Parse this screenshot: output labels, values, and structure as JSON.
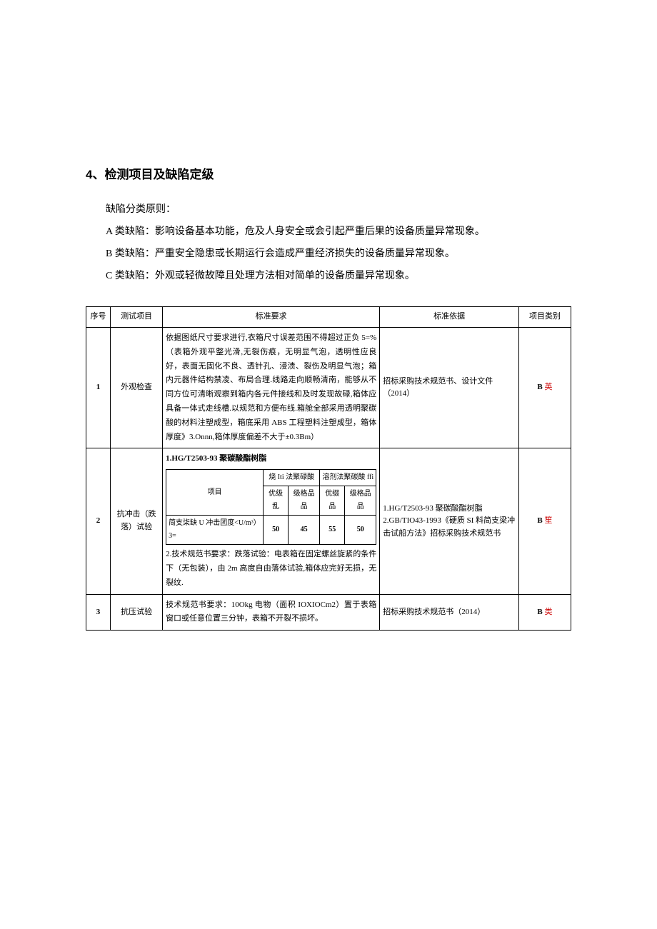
{
  "heading": "4、检测项目及缺陷定级",
  "principles": {
    "intro": "缺陷分类原则：",
    "a": "A 类缺陷：影响设备基本功能，危及人身安全或会引起严重后果的设备质量异常现象。",
    "b": "B 类缺陷：严重安全隐患或长期运行会造成严重经济损失的设备质量异常现象。",
    "c": "C 类缺陷：外观或轻微故障且处理方法相对简单的设备质量异常现象。"
  },
  "table": {
    "headers": {
      "seq": "序号",
      "item": "测试项目",
      "req": "标准要求",
      "basis": "标准依据",
      "cat": "项目类别"
    },
    "rows": [
      {
        "seq": "1",
        "item": "外观检查",
        "req": "依据图纸尺寸要求进行,衣箱尺寸误差范围不得超过正负 5=%（表箱外观平整光滑,无裂伤痕，无明显气泡，透明性应良好，表面无固化不良、透针孔、浸渍、裂伤及明显气泡；箱内元器件结构禁凌、布局合理.线路走向顺畅清南，能够从不同方位可清晰观察到箱内各元件接线和及时发现故碌,箱体应具备一体式走线槽.以规范和方便布线.箱舱全部采用透明聚碳酸的材料注塑成型，箱底采用 ABS 工程塑料注塑成型，箱体厚度》3.Onnn,箱体厚度偏差不大于±0.3Bm）",
        "basis": "招标采购技术规范书、设计文件（2014）",
        "cat_b": "B",
        "cat_lei": "英"
      },
      {
        "seq": "2",
        "item": "抗冲击（跌落）试验",
        "req_header": "1.HG/T2503-93 聚碳酸酯树脂",
        "inner": {
          "h_item": "项目",
          "h_c1": "烧 Iti 法聚碌酸",
          "h_c2": "溶剂法聚碳酸 ffi",
          "r_label": "简支柒缺 U 冲击团度<U/m³）3=",
          "sub1": "优级乱",
          "sub2": "级格品品",
          "sub3": "优缀品",
          "sub4": "级格品品",
          "v1": "50",
          "v2": "45",
          "v3": "55",
          "v4": "50"
        },
        "req_footer": "2.技术规范书要求：跌落试验：电表箱在固定螺丝旋紧的条件下（无包装），由 2m 高度自由落体试验,箱体应完好无损，无裂纹.",
        "basis": "1.HG/T2503-93 聚碳酸酯树脂 2.GB/TIO43-1993《硬质 SI 料简支梁冲击试船方法》招标采购技术规范书",
        "cat_b": "B",
        "cat_lei": "笙"
      },
      {
        "seq": "3",
        "item": "抗压试验",
        "req": "技术规范书要求：10Okg 电物（面积 IOXIOCm2）置于表箱窗口或任意位置三分钟，表箱不开裂不损坏。",
        "basis": "招标采购技术规范书（2014）",
        "cat_b": "B",
        "cat_lei": "类"
      }
    ]
  }
}
